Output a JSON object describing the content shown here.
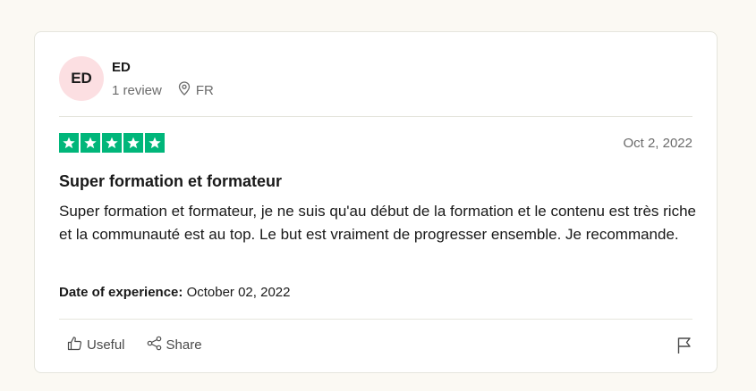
{
  "reviewer": {
    "initials": "ED",
    "name": "ED",
    "review_count": "1 review",
    "country": "FR"
  },
  "review": {
    "rating": 5,
    "rating_max": 5,
    "star_color": "#00b67a",
    "date": "Oct 2, 2022",
    "title": "Super formation et formateur",
    "body": "Super formation et formateur, je ne suis qu'au début de la formation et le contenu est très riche et la communauté est au top. Le but est vraiment de progresser ensemble. Je recommande.",
    "experience_label": "Date of experience:",
    "experience_date": "October 02, 2022"
  },
  "actions": {
    "useful_label": "Useful",
    "share_label": "Share",
    "icons": [
      "thumbs-up-icon",
      "share-icon",
      "flag-icon"
    ]
  }
}
